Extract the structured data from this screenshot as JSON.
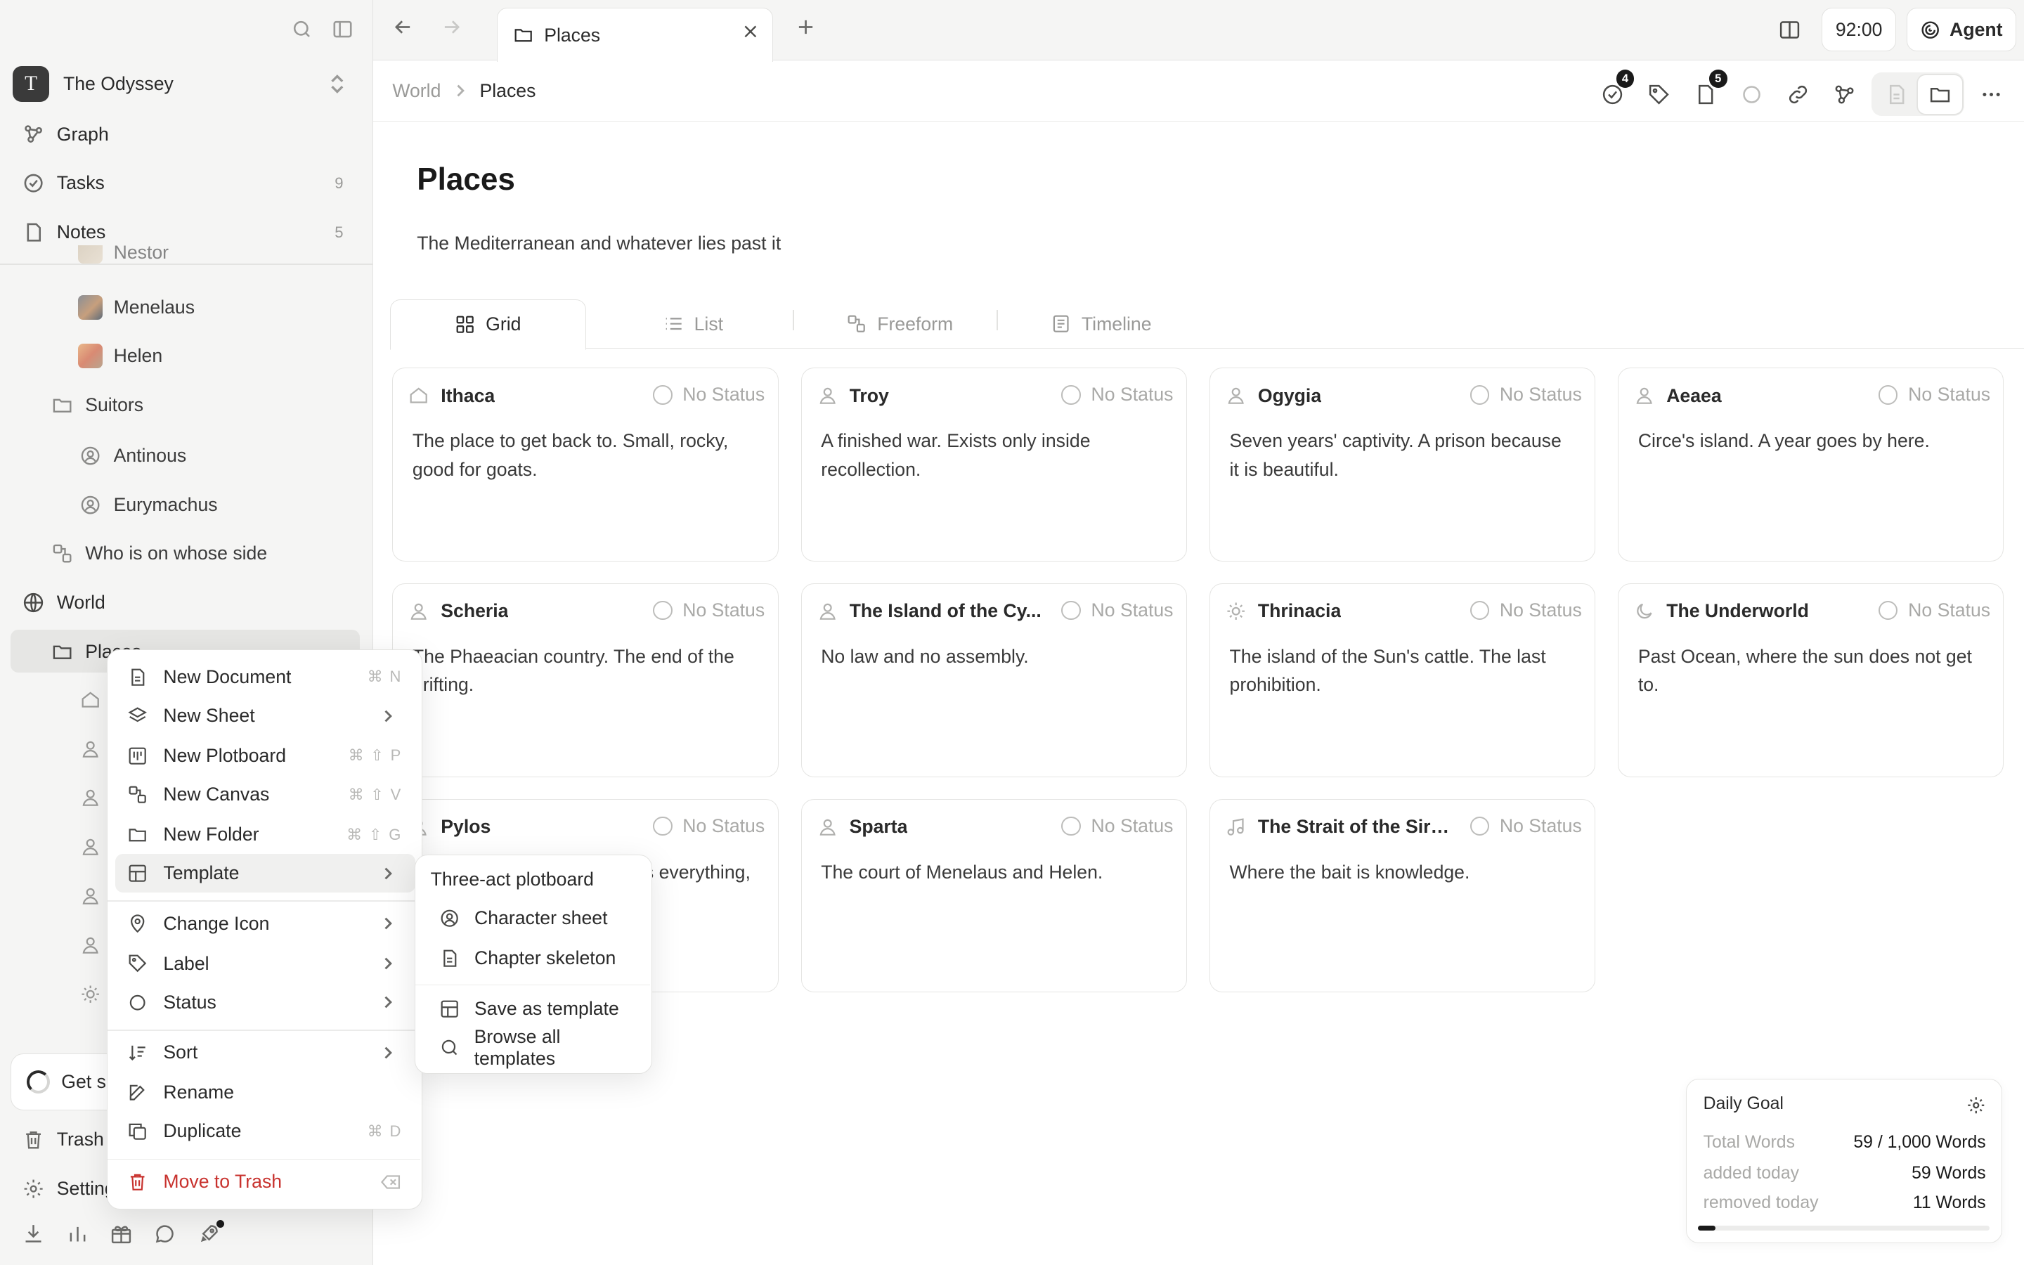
{
  "workspace": {
    "initial": "T",
    "name": "The Odyssey"
  },
  "sidebar": {
    "nav": [
      {
        "label": "Graph"
      },
      {
        "label": "Tasks",
        "count": "9"
      },
      {
        "label": "Notes",
        "count": "5"
      }
    ],
    "tree": {
      "partial": "Nestor",
      "menelaus": "Menelaus",
      "helen": "Helen",
      "suitors": "Suitors",
      "antinous": "Antinous",
      "eurymachus": "Eurymachus",
      "who_side": "Who is on whose side",
      "world": "World",
      "places": "Places"
    },
    "get_started": "Get started",
    "trash": "Trash",
    "settings": "Settings"
  },
  "tab": {
    "label": "Places"
  },
  "timer": "92:00",
  "agent": "Agent",
  "breadcrumb": {
    "parent": "World",
    "current": "Places"
  },
  "toolbar": {
    "tasks_badge": "4",
    "docs_badge": "5"
  },
  "page": {
    "title": "Places",
    "description": "The Mediterranean and whatever lies past it"
  },
  "views": [
    {
      "label": "Grid",
      "active": true
    },
    {
      "label": "List"
    },
    {
      "label": "Freeform"
    },
    {
      "label": "Timeline"
    }
  ],
  "cards": [
    {
      "title": "Ithaca",
      "icon": "home-icon",
      "status": "No Status",
      "body": "The place to get back to. Small, rocky, good for goats."
    },
    {
      "title": "Troy",
      "icon": "person-icon",
      "status": "No Status",
      "body": "A finished war. Exists only inside recollection."
    },
    {
      "title": "Ogygia",
      "icon": "person-icon",
      "status": "No Status",
      "body": "Seven years' captivity. A prison because it is beautiful."
    },
    {
      "title": "Aeaea",
      "icon": "person-icon",
      "status": "No Status",
      "body": "Circe's island. A year goes by here."
    },
    {
      "title": "Scheria",
      "icon": "person-icon",
      "status": "No Status",
      "body": "The Phaeacian country. The end of the drifting."
    },
    {
      "title": "The Island of the Cy...",
      "icon": "person-icon",
      "status": "No Status",
      "body": "No law and no assembly."
    },
    {
      "title": "Thrinacia",
      "icon": "sun-icon",
      "status": "No Status",
      "body": "The island of the Sun's cattle. The last prohibition."
    },
    {
      "title": "The Underworld",
      "icon": "moon-icon",
      "status": "No Status",
      "body": "Past Ocean, where the sun does not get to."
    },
    {
      "title": "Pylos",
      "icon": "person-icon",
      "status": "No Status",
      "body": "The old king who remembers everything, or"
    },
    {
      "title": "Sparta",
      "icon": "person-icon",
      "status": "No Status",
      "body": "The court of Menelaus and Helen."
    },
    {
      "title": "The Strait of the Sirens",
      "icon": "music-icon",
      "status": "No Status",
      "body": "Where the bait is knowledge."
    }
  ],
  "menu": {
    "new_document": "New Document",
    "new_document_sc": "⌘ N",
    "new_sheet": "New Sheet",
    "new_plotboard": "New Plotboard",
    "new_plotboard_sc": "⌘ ⇧ P",
    "new_canvas": "New Canvas",
    "new_canvas_sc": "⌘ ⇧ V",
    "new_folder": "New Folder",
    "new_folder_sc": "⌘ ⇧ G",
    "template": "Template",
    "change_icon": "Change Icon",
    "label": "Label",
    "status": "Status",
    "sort": "Sort",
    "rename": "Rename",
    "duplicate": "Duplicate",
    "duplicate_sc": "⌘ D",
    "move_to_trash": "Move to Trash"
  },
  "submenu": {
    "three_act": "Three-act plotboard",
    "character_sheet": "Character sheet",
    "chapter_skeleton": "Chapter skeleton",
    "save_as_template": "Save as template",
    "browse_all": "Browse all templates"
  },
  "goal": {
    "title": "Daily Goal",
    "total_label": "Total Words",
    "total_value": "59 / 1,000 Words",
    "added_label": "added today",
    "added_value": "59 Words",
    "removed_label": "removed today",
    "removed_value": "11 Words",
    "progress": 0.059
  },
  "colors": {
    "accent": "#1a1a1a",
    "danger": "#c8322e",
    "muted": "#a9a9a7"
  }
}
